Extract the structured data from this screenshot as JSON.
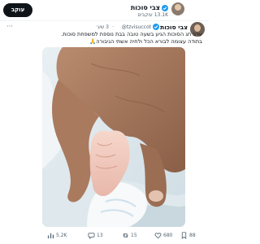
{
  "account_bar": {
    "follow_label": "עוקב",
    "name": "צבי סוכות",
    "followers": "13.1K עוקבים"
  },
  "tweet": {
    "name": "צבי סוכות",
    "handle": "@tzvisuccot",
    "time": "3 שע׳",
    "more": "···",
    "text_line1": "ערב חג הסוכות הגיע בשעה טובה בבת נוספת למשפחת סוכות.",
    "text_line2": "בתודה עצומה לבורא הכל ולחיה אשתי הגיבורה🙏"
  },
  "actions": {
    "views": "5.2K",
    "replies": "13",
    "retweets": "15",
    "likes": "680",
    "bookmarks": "88"
  },
  "colors": {
    "verified": "#1d9bf0",
    "text_secondary": "#536471",
    "follow_bg": "#0f1419"
  },
  "icons": {
    "follow_button": "pill-button",
    "verified": "verified-badge-icon",
    "more": "more-icon",
    "views": "views-icon",
    "reply": "reply-icon",
    "retweet": "retweet-icon",
    "like": "heart-icon",
    "bookmark": "bookmark-icon"
  }
}
